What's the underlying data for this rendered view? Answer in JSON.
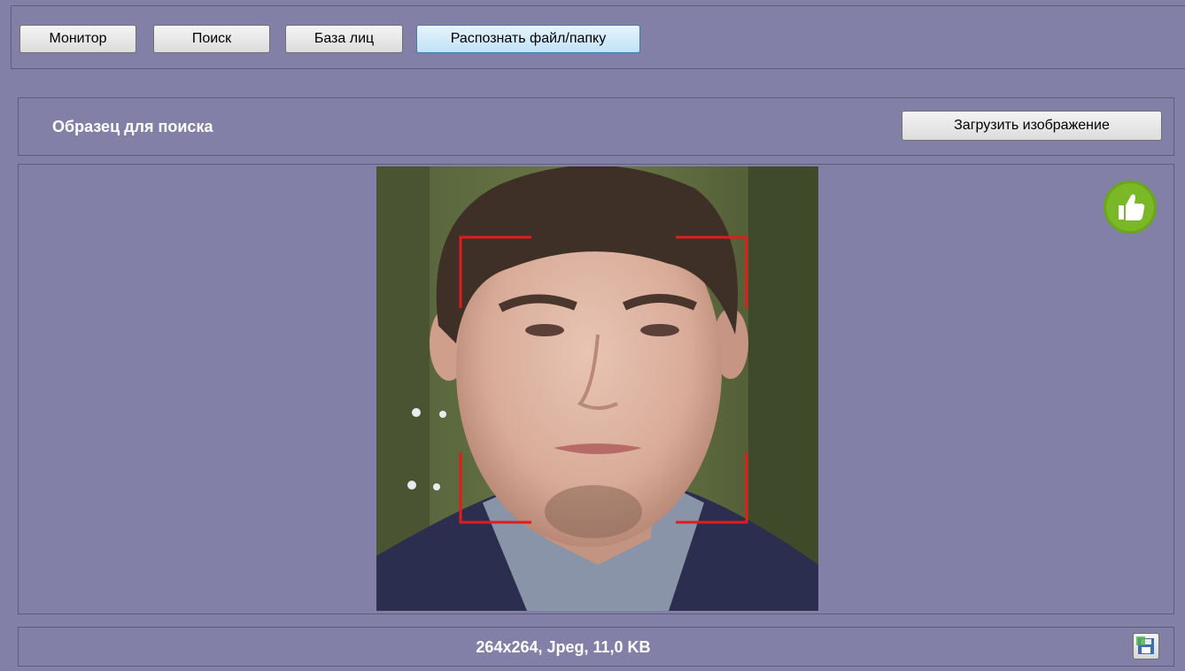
{
  "toolbar": {
    "buttons": [
      {
        "label": "Монитор",
        "active": false
      },
      {
        "label": "Поиск",
        "active": false
      },
      {
        "label": "База лиц",
        "active": false
      },
      {
        "label": "Распознать файл/папку",
        "active": true
      }
    ]
  },
  "sample": {
    "title": "Образец для поиска",
    "upload_label": "Загрузить изображение"
  },
  "image": {
    "info": "264x264, Jpeg, 11,0 KB",
    "status_icon": "thumbs-up-icon",
    "frame_color": "#e41b1b"
  },
  "colors": {
    "background": "#8380a8",
    "accent_green": "#6aa61a"
  }
}
